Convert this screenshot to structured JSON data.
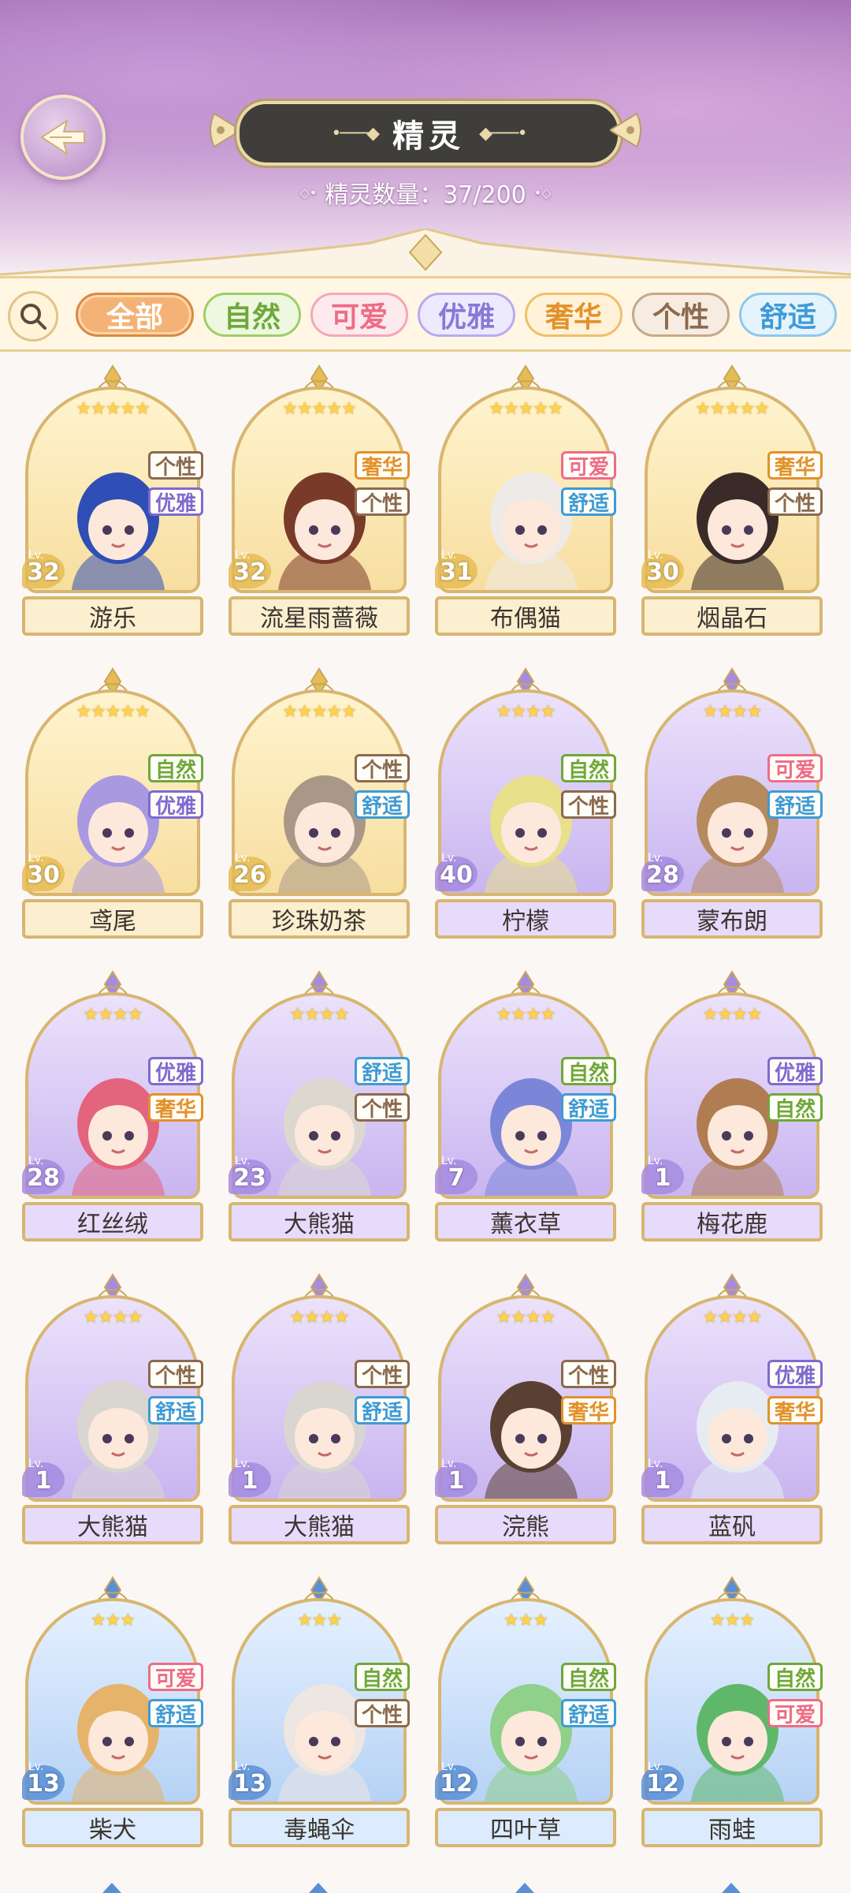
{
  "header": {
    "title": "精灵",
    "count_label": "精灵数量：37/200",
    "back_icon": "back-arrow-icon"
  },
  "filters": [
    {
      "label": "全部",
      "color": "#ffffff",
      "border": "#d98a45",
      "bg": "#f5b276",
      "active": true
    },
    {
      "label": "自然",
      "color": "#6fa83a",
      "border": "#9ccf67",
      "bg": "#eef8e0",
      "active": false
    },
    {
      "label": "可爱",
      "color": "#ee6c86",
      "border": "#f5a8b6",
      "bg": "#fdeaee",
      "active": false
    },
    {
      "label": "优雅",
      "color": "#8a78d8",
      "border": "#b9aaf0",
      "bg": "#eeeafd",
      "active": false
    },
    {
      "label": "奢华",
      "color": "#e2912b",
      "border": "#f0bf6b",
      "bg": "#fff2d9",
      "active": false
    },
    {
      "label": "个性",
      "color": "#8b6a4f",
      "border": "#c6a888",
      "bg": "#f6ece2",
      "active": false
    },
    {
      "label": "舒适",
      "color": "#3e9bd6",
      "border": "#8ec8ee",
      "bg": "#e5f3fc",
      "active": false
    }
  ],
  "tag_colors": {
    "个性": "#8b6a4f",
    "优雅": "#7d6bd0",
    "奢华": "#e2912b",
    "可爱": "#ee6c86",
    "舒适": "#3e9bd6",
    "自然": "#6fa83a"
  },
  "spirits": [
    {
      "name": "游乐",
      "level": "32",
      "stars": "★★★★★",
      "tags": [
        "个性",
        "优雅"
      ],
      "rarity": "gold",
      "hair": "#2f4fb6"
    },
    {
      "name": "流星雨蔷薇",
      "level": "32",
      "stars": "★★★★★",
      "tags": [
        "奢华",
        "个性"
      ],
      "rarity": "gold",
      "hair": "#7a3a2a"
    },
    {
      "name": "布偶猫",
      "level": "31",
      "stars": "★★★★★",
      "tags": [
        "可爱",
        "舒适"
      ],
      "rarity": "gold",
      "hair": "#eeeae8"
    },
    {
      "name": "烟晶石",
      "level": "30",
      "stars": "★★★★★",
      "tags": [
        "奢华",
        "个性"
      ],
      "rarity": "gold",
      "hair": "#3a2a28"
    },
    {
      "name": "鸢尾",
      "level": "30",
      "stars": "★★★★★",
      "tags": [
        "自然",
        "优雅"
      ],
      "rarity": "gold",
      "hair": "#a999e0"
    },
    {
      "name": "珍珠奶茶",
      "level": "26",
      "stars": "★★★★★",
      "tags": [
        "个性",
        "舒适"
      ],
      "rarity": "gold",
      "hair": "#a99887"
    },
    {
      "name": "柠檬",
      "level": "40",
      "stars": "★★★★",
      "tags": [
        "自然",
        "个性"
      ],
      "rarity": "purple",
      "hair": "#e8e08a"
    },
    {
      "name": "蒙布朗",
      "level": "28",
      "stars": "★★★★",
      "tags": [
        "可爱",
        "舒适"
      ],
      "rarity": "purple",
      "hair": "#b58a5f"
    },
    {
      "name": "红丝绒",
      "level": "28",
      "stars": "★★★★",
      "tags": [
        "优雅",
        "奢华"
      ],
      "rarity": "purple",
      "hair": "#e3647c"
    },
    {
      "name": "大熊猫",
      "level": "23",
      "stars": "★★★★",
      "tags": [
        "舒适",
        "个性"
      ],
      "rarity": "purple",
      "hair": "#dcd8d0"
    },
    {
      "name": "薰衣草",
      "level": "7",
      "stars": "★★★★",
      "tags": [
        "自然",
        "舒适"
      ],
      "rarity": "purple",
      "hair": "#7c86d8"
    },
    {
      "name": "梅花鹿",
      "level": "1",
      "stars": "★★★★",
      "tags": [
        "优雅",
        "自然"
      ],
      "rarity": "purple",
      "hair": "#b07c52"
    },
    {
      "name": "大熊猫",
      "level": "1",
      "stars": "★★★★",
      "tags": [
        "个性",
        "舒适"
      ],
      "rarity": "purple",
      "hair": "#d9d6d2"
    },
    {
      "name": "大熊猫",
      "level": "1",
      "stars": "★★★★",
      "tags": [
        "个性",
        "舒适"
      ],
      "rarity": "purple",
      "hair": "#d9d6d2"
    },
    {
      "name": "浣熊",
      "level": "1",
      "stars": "★★★★",
      "tags": [
        "个性",
        "奢华"
      ],
      "rarity": "purple",
      "hair": "#5a4032"
    },
    {
      "name": "蓝矾",
      "level": "1",
      "stars": "★★★★",
      "tags": [
        "优雅",
        "奢华"
      ],
      "rarity": "purple",
      "hair": "#e6ecf2"
    },
    {
      "name": "柴犬",
      "level": "13",
      "stars": "★★★",
      "tags": [
        "可爱",
        "舒适"
      ],
      "rarity": "blue",
      "hair": "#e5b36a"
    },
    {
      "name": "毒蝇伞",
      "level": "13",
      "stars": "★★★",
      "tags": [
        "自然",
        "个性"
      ],
      "rarity": "blue",
      "hair": "#ede6e2"
    },
    {
      "name": "四叶草",
      "level": "12",
      "stars": "★★★",
      "tags": [
        "自然",
        "舒适"
      ],
      "rarity": "blue",
      "hair": "#8fd08a"
    },
    {
      "name": "雨蛙",
      "level": "12",
      "stars": "★★★",
      "tags": [
        "自然",
        "可爱"
      ],
      "rarity": "blue",
      "hair": "#5fb86a"
    }
  ]
}
